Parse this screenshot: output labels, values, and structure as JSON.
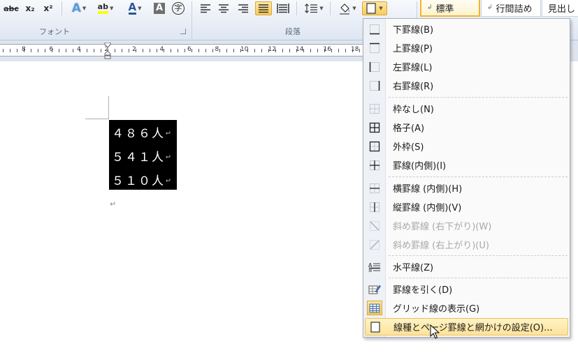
{
  "ribbon": {
    "font_group_label": "フォント",
    "paragraph_group_label": "段落",
    "font_buttons": {
      "strikethrough": "abc",
      "subscript": "x₂",
      "superscript": "x²",
      "text_effect": "A",
      "highlight": "ab",
      "font_color": "A",
      "char_shading": "A",
      "enclose": "字"
    },
    "styles": [
      {
        "mark": "↲",
        "label": "標準"
      },
      {
        "mark": "↲",
        "label": "行間詰め"
      },
      {
        "mark": "",
        "label": "見出し"
      }
    ]
  },
  "ruler": {
    "numbers": [
      "8",
      "6",
      "4",
      "2",
      "2",
      "4",
      "6",
      "8",
      "10",
      "12",
      "14",
      "16",
      "18"
    ]
  },
  "document": {
    "lines": [
      "４８６人",
      "５４１人",
      "５１０人"
    ],
    "return_mark": "↵",
    "paragraph_mark": "↵"
  },
  "border_menu": {
    "items": [
      {
        "label": "下罫線(B)",
        "icon": "bottom-border-icon",
        "enabled": true
      },
      {
        "label": "上罫線(P)",
        "icon": "top-border-icon",
        "enabled": true
      },
      {
        "label": "左罫線(L)",
        "icon": "left-border-icon",
        "enabled": true
      },
      {
        "label": "右罫線(R)",
        "icon": "right-border-icon",
        "enabled": true
      },
      {
        "label": "枠なし(N)",
        "icon": "no-border-icon",
        "enabled": true
      },
      {
        "label": "格子(A)",
        "icon": "all-borders-icon",
        "enabled": true
      },
      {
        "label": "外枠(S)",
        "icon": "outside-borders-icon",
        "enabled": true
      },
      {
        "label": "罫線(内側)(I)",
        "icon": "inside-borders-icon",
        "enabled": true
      },
      {
        "label": "横罫線 (内側)(H)",
        "icon": "inside-horizontal-border-icon",
        "enabled": true
      },
      {
        "label": "縦罫線 (内側)(V)",
        "icon": "inside-vertical-border-icon",
        "enabled": true
      },
      {
        "label": "斜め罫線 (右下がり)(W)",
        "icon": "diagonal-down-border-icon",
        "enabled": false
      },
      {
        "label": "斜め罫線 (右上がり)(U)",
        "icon": "diagonal-up-border-icon",
        "enabled": false
      },
      {
        "label": "水平線(Z)",
        "icon": "horizontal-line-icon",
        "enabled": true
      },
      {
        "label": "罫線を引く(D)",
        "icon": "draw-table-icon",
        "enabled": true
      },
      {
        "label": "グリッド線の表示(G)",
        "icon": "view-gridlines-icon",
        "enabled": true
      },
      {
        "label": "線種とページ罫線と網かけの設定(O)...",
        "icon": "borders-shading-icon",
        "enabled": true,
        "highlighted": true
      }
    ]
  },
  "colors": {
    "highlight": "#fde29a",
    "active_button": "#f9cb5a",
    "ribbon": "#dde6f2"
  }
}
